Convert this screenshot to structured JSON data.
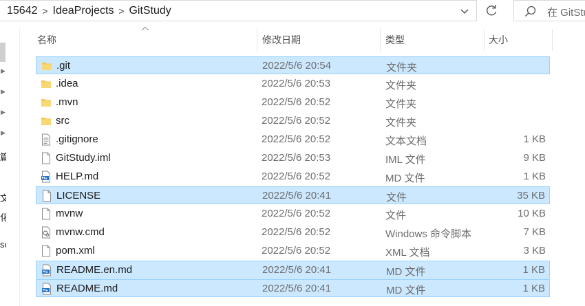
{
  "address_bar": {
    "breadcrumbs": [
      "15642",
      "IdeaProjects",
      "GitStudy"
    ],
    "separator": ">"
  },
  "search": {
    "placeholder": "在 GitStudy"
  },
  "nav_pane_fragments": [
    "篇",
    "文",
    "化",
    "sc"
  ],
  "columns": {
    "name": "名称",
    "date": "修改日期",
    "type": "类型",
    "size": "大小"
  },
  "files": [
    {
      "name": ".git",
      "date": "2022/5/6 20:54",
      "type": "文件夹",
      "size": "",
      "icon": "folder-icon",
      "selected": true
    },
    {
      "name": ".idea",
      "date": "2022/5/6 20:53",
      "type": "文件夹",
      "size": "",
      "icon": "folder-icon",
      "selected": false
    },
    {
      "name": ".mvn",
      "date": "2022/5/6 20:52",
      "type": "文件夹",
      "size": "",
      "icon": "folder-icon",
      "selected": false
    },
    {
      "name": "src",
      "date": "2022/5/6 20:52",
      "type": "文件夹",
      "size": "",
      "icon": "folder-icon",
      "selected": false
    },
    {
      "name": ".gitignore",
      "date": "2022/5/6 20:52",
      "type": "文本文档",
      "size": "1 KB",
      "icon": "text-file-icon",
      "selected": false
    },
    {
      "name": "GitStudy.iml",
      "date": "2022/5/6 20:53",
      "type": "IML 文件",
      "size": "9 KB",
      "icon": "blank-file-icon",
      "selected": false
    },
    {
      "name": "HELP.md",
      "date": "2022/5/6 20:52",
      "type": "MD 文件",
      "size": "1 KB",
      "icon": "markdown-file-icon",
      "selected": false
    },
    {
      "name": "LICENSE",
      "date": "2022/5/6 20:41",
      "type": "文件",
      "size": "35 KB",
      "icon": "blank-file-icon",
      "selected": true
    },
    {
      "name": "mvnw",
      "date": "2022/5/6 20:52",
      "type": "文件",
      "size": "10 KB",
      "icon": "blank-file-icon",
      "selected": false
    },
    {
      "name": "mvnw.cmd",
      "date": "2022/5/6 20:52",
      "type": "Windows 命令脚本",
      "size": "7 KB",
      "icon": "script-file-icon",
      "selected": false
    },
    {
      "name": "pom.xml",
      "date": "2022/5/6 20:52",
      "type": "XML 文档",
      "size": "3 KB",
      "icon": "blank-file-icon",
      "selected": false
    },
    {
      "name": "README.en.md",
      "date": "2022/5/6 20:41",
      "type": "MD 文件",
      "size": "1 KB",
      "icon": "markdown-file-icon",
      "selected": true
    },
    {
      "name": "README.md",
      "date": "2022/5/6 20:41",
      "type": "MD 文件",
      "size": "1 KB",
      "icon": "markdown-file-icon",
      "selected": true
    }
  ],
  "colors": {
    "selection_bg": "#cce8ff",
    "selection_border": "#99d1ff",
    "folder": "#f3c64f",
    "markdown_icon": "#1f6fc5"
  }
}
